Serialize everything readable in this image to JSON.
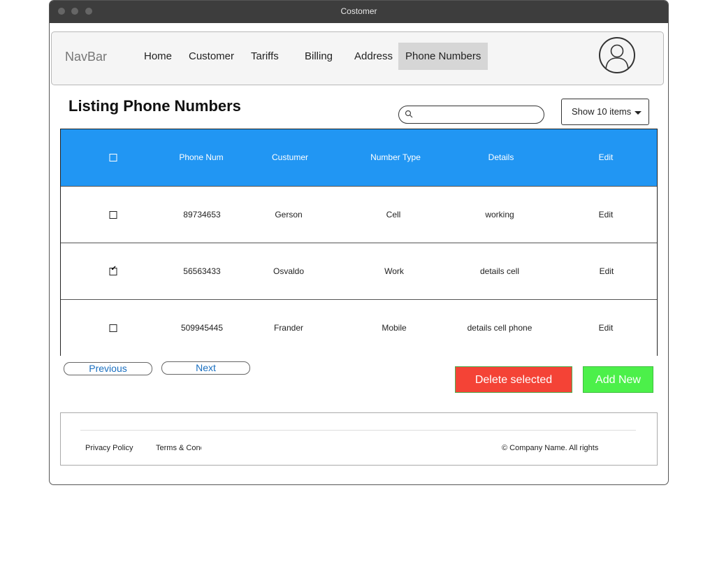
{
  "window": {
    "title": "Costomer"
  },
  "navbar": {
    "brand": "NavBar",
    "items": [
      {
        "label": "Home"
      },
      {
        "label": "Customer"
      },
      {
        "label": "Tariffs"
      },
      {
        "label": "Billing"
      },
      {
        "label": "Address"
      },
      {
        "label": "Phone Numbers",
        "active": true
      }
    ]
  },
  "page": {
    "title": "Listing Phone Numbers"
  },
  "search": {
    "value": "",
    "placeholder": ""
  },
  "show_select": {
    "selected": "Show 10 items"
  },
  "table": {
    "headers": [
      "Phone Num",
      "Custumer",
      "Number Type",
      "Details",
      "Edit"
    ],
    "rows": [
      {
        "checked": false,
        "phone": "89734653",
        "customer": "Gerson",
        "type": "Cell",
        "details": "working",
        "edit": "Edit"
      },
      {
        "checked": true,
        "phone": "56563433",
        "customer": "Osvaldo",
        "type": "Work",
        "details": "details cell",
        "edit": "Edit"
      },
      {
        "checked": false,
        "phone": "509945445",
        "customer": "Frander",
        "type": "Mobile",
        "details": "details cell phone",
        "edit": "Edit"
      }
    ],
    "header_color": "#2196f3"
  },
  "pagination": {
    "previous": "Previous",
    "next": "Next"
  },
  "actions": {
    "delete": "Delete selected",
    "add": "Add New",
    "delete_color": "#f44336",
    "add_color": "#4cf04a"
  },
  "footer": {
    "privacy": "Privacy Policy",
    "terms": "Terms & Conc",
    "copyright": "©  Company Name.  All rights"
  }
}
